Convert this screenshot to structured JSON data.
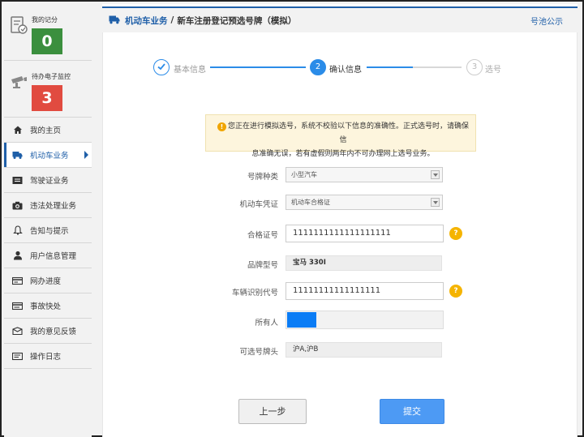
{
  "sidebar": {
    "stats": [
      {
        "title": "我的记分",
        "value": "0",
        "color": "#3b8f3e"
      },
      {
        "title": "待办电子监控",
        "value": "3",
        "color": "#e14b40"
      }
    ],
    "items": [
      {
        "label": "我的主页",
        "icon": "home-icon"
      },
      {
        "label": "机动车业务",
        "icon": "truck-icon",
        "active": true
      },
      {
        "label": "驾驶证业务",
        "icon": "license-card-icon"
      },
      {
        "label": "违法处理业务",
        "icon": "camera-icon"
      },
      {
        "label": "告知与提示",
        "icon": "bell-icon"
      },
      {
        "label": "用户信息管理",
        "icon": "user-icon"
      },
      {
        "label": "网办进度",
        "icon": "progress-card-icon"
      },
      {
        "label": "事故快处",
        "icon": "accident-card-icon"
      },
      {
        "label": "我的意见反馈",
        "icon": "feedback-icon"
      },
      {
        "label": "操作日志",
        "icon": "log-icon"
      }
    ]
  },
  "header": {
    "section": "机动车业务",
    "separator": "/",
    "title": "新车注册登记预选号牌（模拟）",
    "link": "号池公示"
  },
  "steps": [
    {
      "num": "1",
      "label": "基本信息",
      "state": "done"
    },
    {
      "num": "2",
      "label": "确认信息",
      "state": "active"
    },
    {
      "num": "3",
      "label": "选号",
      "state": "pending"
    }
  ],
  "notice": {
    "line1": "您正在进行模拟选号，系统不校验以下信息的准确性。正式选号时，请确保信",
    "line2": "息准确无误，若有虚假则两年内不可办理网上选号业务。"
  },
  "form": {
    "plate_type": {
      "label": "号牌种类",
      "value": "小型汽车"
    },
    "vehicle_cert": {
      "label": "机动车凭证",
      "value": "机动车合格证"
    },
    "cert_no": {
      "label": "合格证号",
      "value": "1111111111111111111"
    },
    "brand_model": {
      "label": "品牌型号",
      "value": "宝马 330I"
    },
    "vin": {
      "label": "车辆识别代号",
      "value": "11111111111111111"
    },
    "owner": {
      "label": "所有人",
      "value": ""
    },
    "plate_prefix": {
      "label": "可选号牌头",
      "value": "沪A,沪B"
    },
    "help_glyph": "?"
  },
  "buttons": {
    "prev": "上一步",
    "submit": "提交"
  },
  "colors": {
    "accent": "#1f5fa8",
    "step_active": "#2b8ce8",
    "button_primary": "#4d9af4"
  }
}
